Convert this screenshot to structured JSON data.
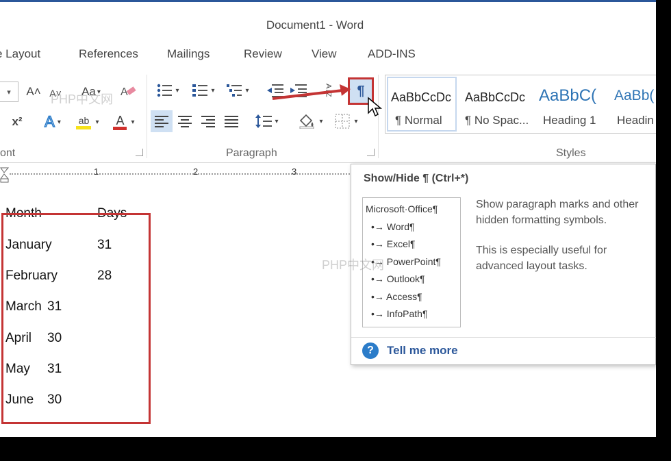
{
  "window": {
    "title": "Document1 - Word"
  },
  "tabs": [
    "e Layout",
    "References",
    "Mailings",
    "Review",
    "View",
    "ADD-INS"
  ],
  "ribbon": {
    "font_group_label": "ont",
    "paragraph_group_label": "Paragraph",
    "styles_group_label": "Styles",
    "grow_font": "A˄",
    "shrink_font": "A˅",
    "change_case": "Aa",
    "superscript": "x²",
    "text_effects": "A",
    "highlight": "ab",
    "font_color": "A",
    "sort": "A↓Z",
    "show_hide": "¶"
  },
  "styles": [
    {
      "sample": "AaBbCcDc",
      "name": "¶ Normal",
      "selected": true
    },
    {
      "sample": "AaBbCcDc",
      "name": "¶ No Spac...",
      "selected": false
    },
    {
      "sample": "AaBbC(",
      "name": "Heading 1",
      "selected": false
    },
    {
      "sample": "AaBb(",
      "name": "Headin",
      "selected": false
    }
  ],
  "ruler": {
    "marks": [
      "1",
      "2",
      "3"
    ]
  },
  "document": {
    "header": {
      "month": "Month",
      "days": "Days"
    },
    "rows": [
      {
        "month": "January",
        "days": "31"
      },
      {
        "month": "February",
        "days": "28"
      },
      {
        "month": "March",
        "days": "31"
      },
      {
        "month": "April",
        "days": "30"
      },
      {
        "month": "May",
        "days": "31"
      },
      {
        "month": "June",
        "days": "30"
      }
    ]
  },
  "tooltip": {
    "title": "Show/Hide ¶ (Ctrl+*)",
    "sample_lines": [
      "Microsoft·Office¶",
      "•→ Word¶",
      "•→ Excel¶",
      "•→ PowerPoint¶",
      "•→ Outlook¶",
      "•→ Access¶",
      "•→ InfoPath¶"
    ],
    "desc_1": "Show paragraph marks and other",
    "desc_2": "hidden formatting symbols.",
    "desc_3": "This is especially useful for",
    "desc_4": "advanced layout tasks.",
    "more_label": "Tell me more"
  },
  "watermarks": [
    "PHP中文网",
    "PHP中文网"
  ],
  "colors": {
    "accent": "#2b579a",
    "annotation_red": "#c43434",
    "highlight_yellow": "#f7e21b",
    "font_red": "#d0312d"
  }
}
